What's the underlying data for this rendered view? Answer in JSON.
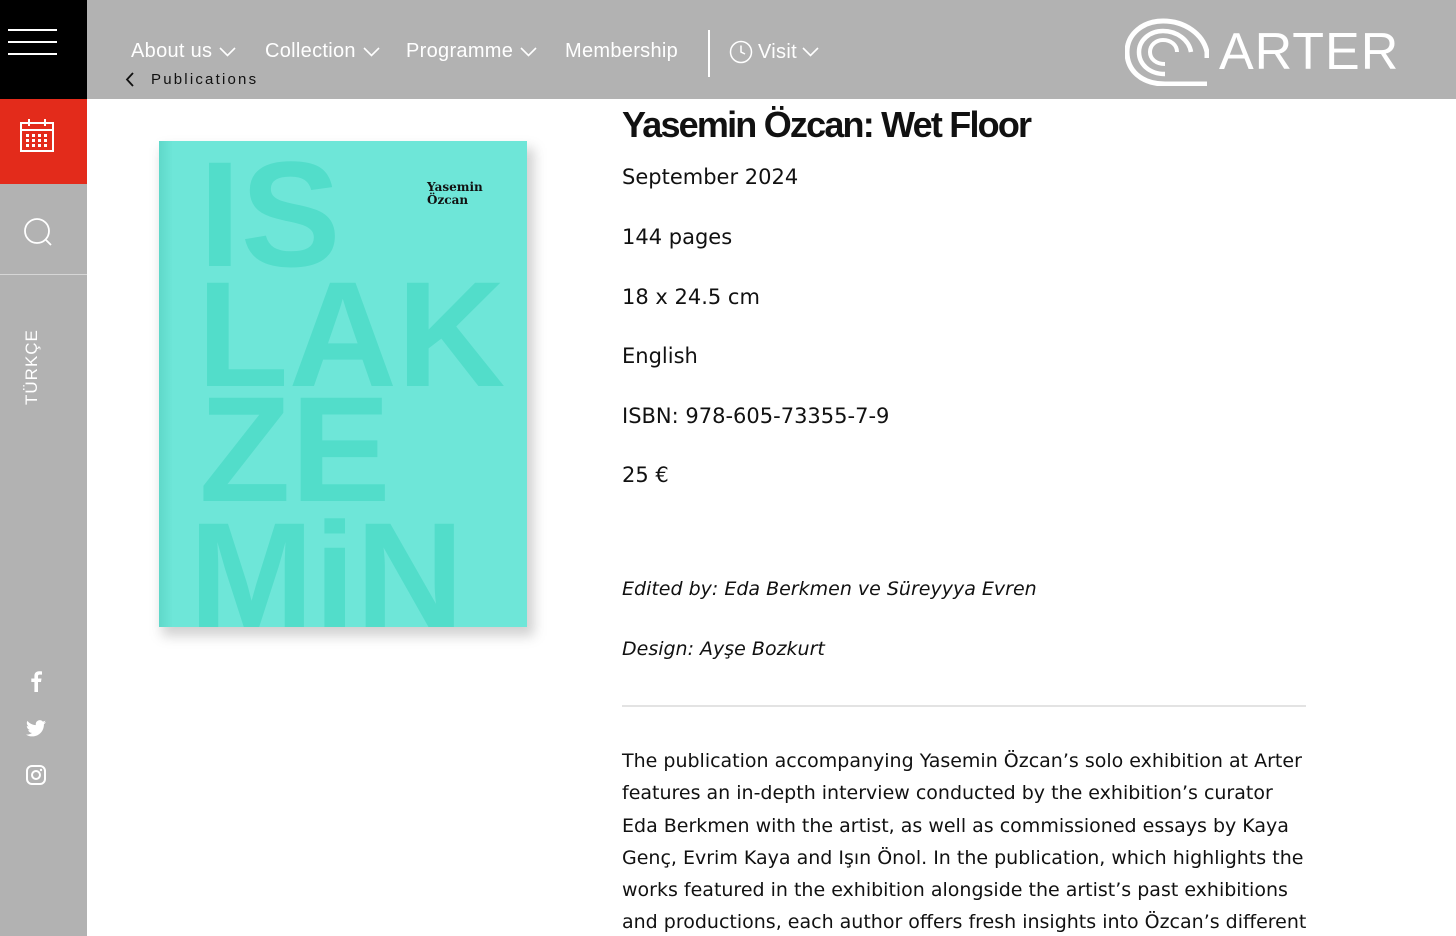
{
  "sidebar": {
    "menu_icon": "hamburger-icon",
    "calendar_icon": "calendar-icon",
    "search_icon": "search-icon",
    "language": "TÜRKÇE",
    "social": [
      "facebook-icon",
      "twitter-icon",
      "instagram-icon"
    ],
    "colors": {
      "background": "#b2b2b2",
      "menu_bg": "#000000",
      "calendar_bg": "#e32b1b"
    }
  },
  "nav": {
    "items": [
      {
        "label": "About us",
        "has_dropdown": true
      },
      {
        "label": "Collection",
        "has_dropdown": true
      },
      {
        "label": "Programme",
        "has_dropdown": true
      },
      {
        "label": "Membership",
        "has_dropdown": false
      },
      {
        "label": "Visit",
        "has_dropdown": true,
        "icon": "clock-icon"
      }
    ],
    "breadcrumb": "Publications",
    "logo_text": "ARTER"
  },
  "book": {
    "cover_author": "Yasemin\nÖzcan",
    "cover_title_lines": [
      "IS",
      "LAK",
      "ZE",
      "MiN"
    ],
    "cover_color": "#6ee6d8",
    "title": "Yasemin Özcan: Wet Floor",
    "date": "September 2024",
    "pages": "144 pages",
    "size": "18 x 24.5 cm",
    "language": "English",
    "isbn": "ISBN: 978-605-73355-7-9",
    "price": "25 €",
    "edited_by": "Edited by: Eda Berkmen ve Süreyyya Evren",
    "design": "Design: Ayşe Bozkurt",
    "description": "The publication accompanying Yasemin Özcan’s solo exhibition at Arter features an in-depth interview conducted by the exhibition’s curator Eda Berkmen with the artist, as well as commissioned essays by Kaya Genç, Evrim Kaya and Işın Önol. In the publication, which highlights the works featured in the exhibition alongside the artist’s past exhibitions and productions, each author offers fresh insights into Özcan’s different works."
  }
}
